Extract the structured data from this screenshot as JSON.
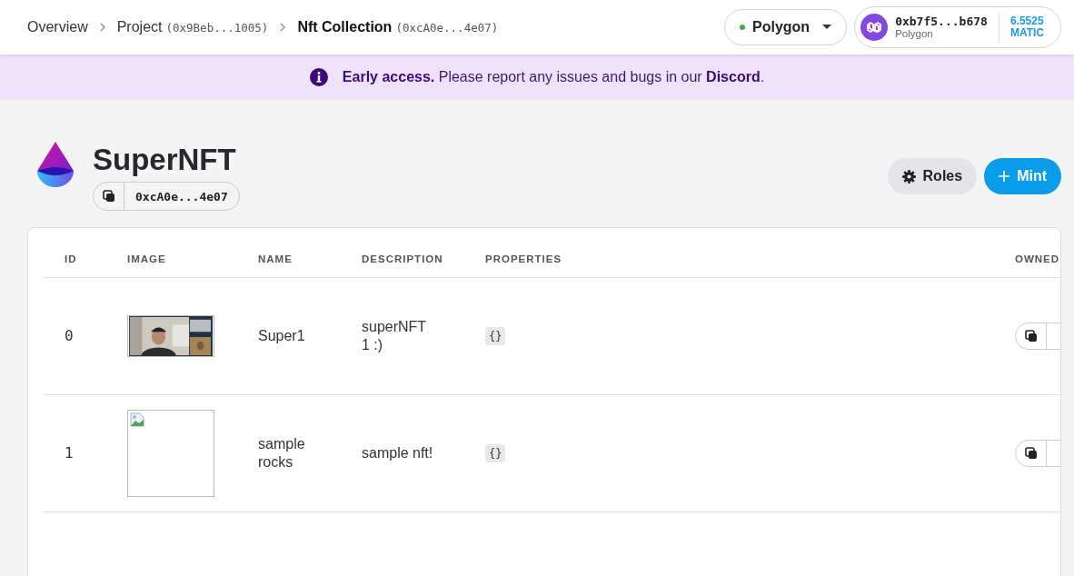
{
  "breadcrumbs": [
    {
      "label": "Overview",
      "selected": false
    },
    {
      "label": "Project",
      "address": "(0x9Beb...1005)",
      "selected": false
    },
    {
      "label": "Nft Collection",
      "address": "(0xcA0e...4e07)",
      "selected": true
    }
  ],
  "network_selector": {
    "label": "Polygon",
    "connected": true
  },
  "wallet": {
    "address": "0xb7f5...b678",
    "network": "Polygon",
    "balance": "6.5525",
    "currency": "MATIC"
  },
  "banner": {
    "text": "**Early access.** Please report any issues and bugs in our **Discord**."
  },
  "contract": {
    "name": "SuperNFT",
    "address": "0xcA0e...4e07"
  },
  "actions": [
    {
      "kind": "secondary",
      "label": "Roles"
    },
    {
      "kind": "primary",
      "label": "Mint"
    }
  ],
  "table": {
    "columns": [
      "ID",
      "IMAGE",
      "NAME",
      "DESCRIPTION",
      "PROPERTIES",
      "OWNED"
    ],
    "rows": [
      {
        "id": "0",
        "name": "Super1",
        "description": "superNFT 1 :)",
        "properties": "{}"
      },
      {
        "id": "1",
        "image": {
          "kind": "broken"
        },
        "name": "sample rocks",
        "description": "sample nft!",
        "properties": "{}"
      }
    ]
  }
}
